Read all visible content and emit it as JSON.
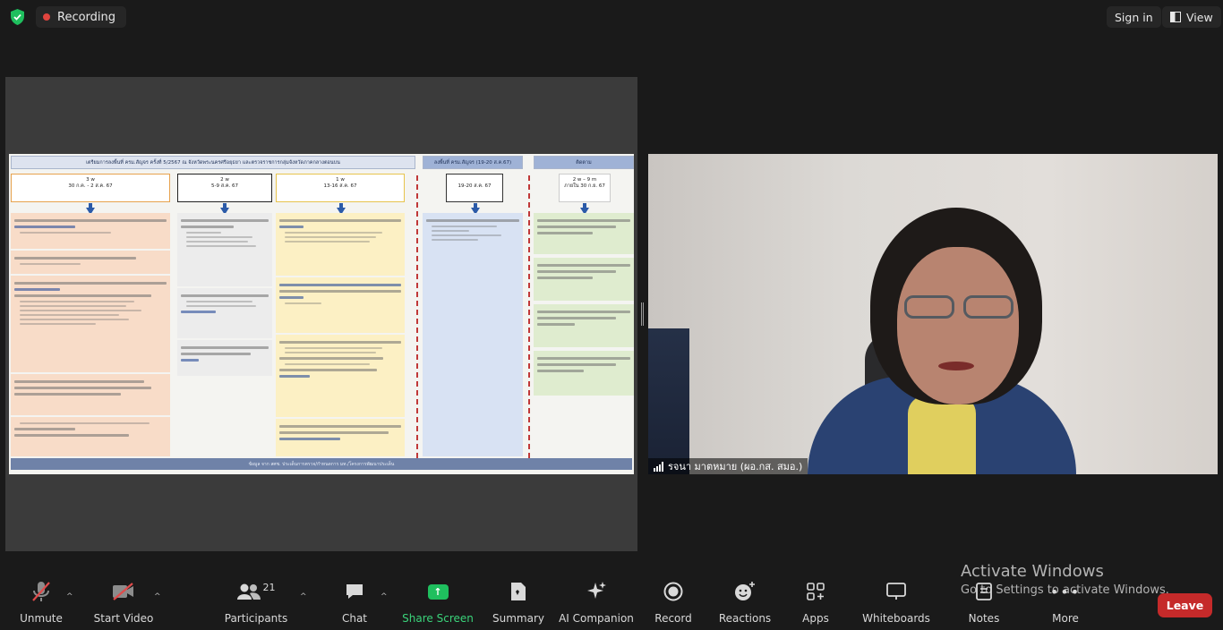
{
  "top_bar": {
    "recording_label": "Recording",
    "sign_in_label": "Sign in",
    "view_label": "View"
  },
  "slide": {
    "headers": [
      "เตรียมการลงพื้นที่ ครม.สัญจร ครั้งที่ 5/2567 ณ จังหวัดพระนครศรีอยุธยา และตรวจราชการกลุ่มจังหวัดภาคกลางตอนบน",
      "ลงพื้นที่ ครม.สัญจร (19-20 ส.ค.67)",
      "ติดตาม"
    ],
    "timeline": [
      {
        "label": "3 w",
        "dates": "30 ก.ค. - 2 ส.ค. 67"
      },
      {
        "label": "2 w",
        "dates": "5-9 ส.ค. 67"
      },
      {
        "label": "1 w",
        "dates": "13-16 ส.ค. 67"
      },
      {
        "label": "",
        "dates": "19-20 ส.ค. 67"
      },
      {
        "label": "2 w – 9 m",
        "dates": "ภายใน 30 ก.ย. 67"
      }
    ],
    "footer": "ข้อมูล จาก สศช. ประเด็นการตรวจ/กำหนดการ มท./โครงการพัฒนาประเด็น"
  },
  "participant_video": {
    "name": "รจนา มาตหมาย (ผอ.กส. สมอ.)"
  },
  "activate_windows": {
    "title": "Activate Windows",
    "subtitle": "Go to Settings to activate Windows."
  },
  "toolbar": {
    "unmute": "Unmute",
    "start_video": "Start Video",
    "participants": "Participants",
    "participants_count": "21",
    "chat": "Chat",
    "share_screen": "Share Screen",
    "summary": "Summary",
    "ai_companion": "AI Companion",
    "record": "Record",
    "reactions": "Reactions",
    "apps": "Apps",
    "whiteboards": "Whiteboards",
    "notes": "Notes",
    "more": "More",
    "leave": "Leave"
  },
  "colors": {
    "accent_green": "#1fbf5e",
    "leave_red": "#c52a2a",
    "recording_dot": "#e0443e"
  }
}
